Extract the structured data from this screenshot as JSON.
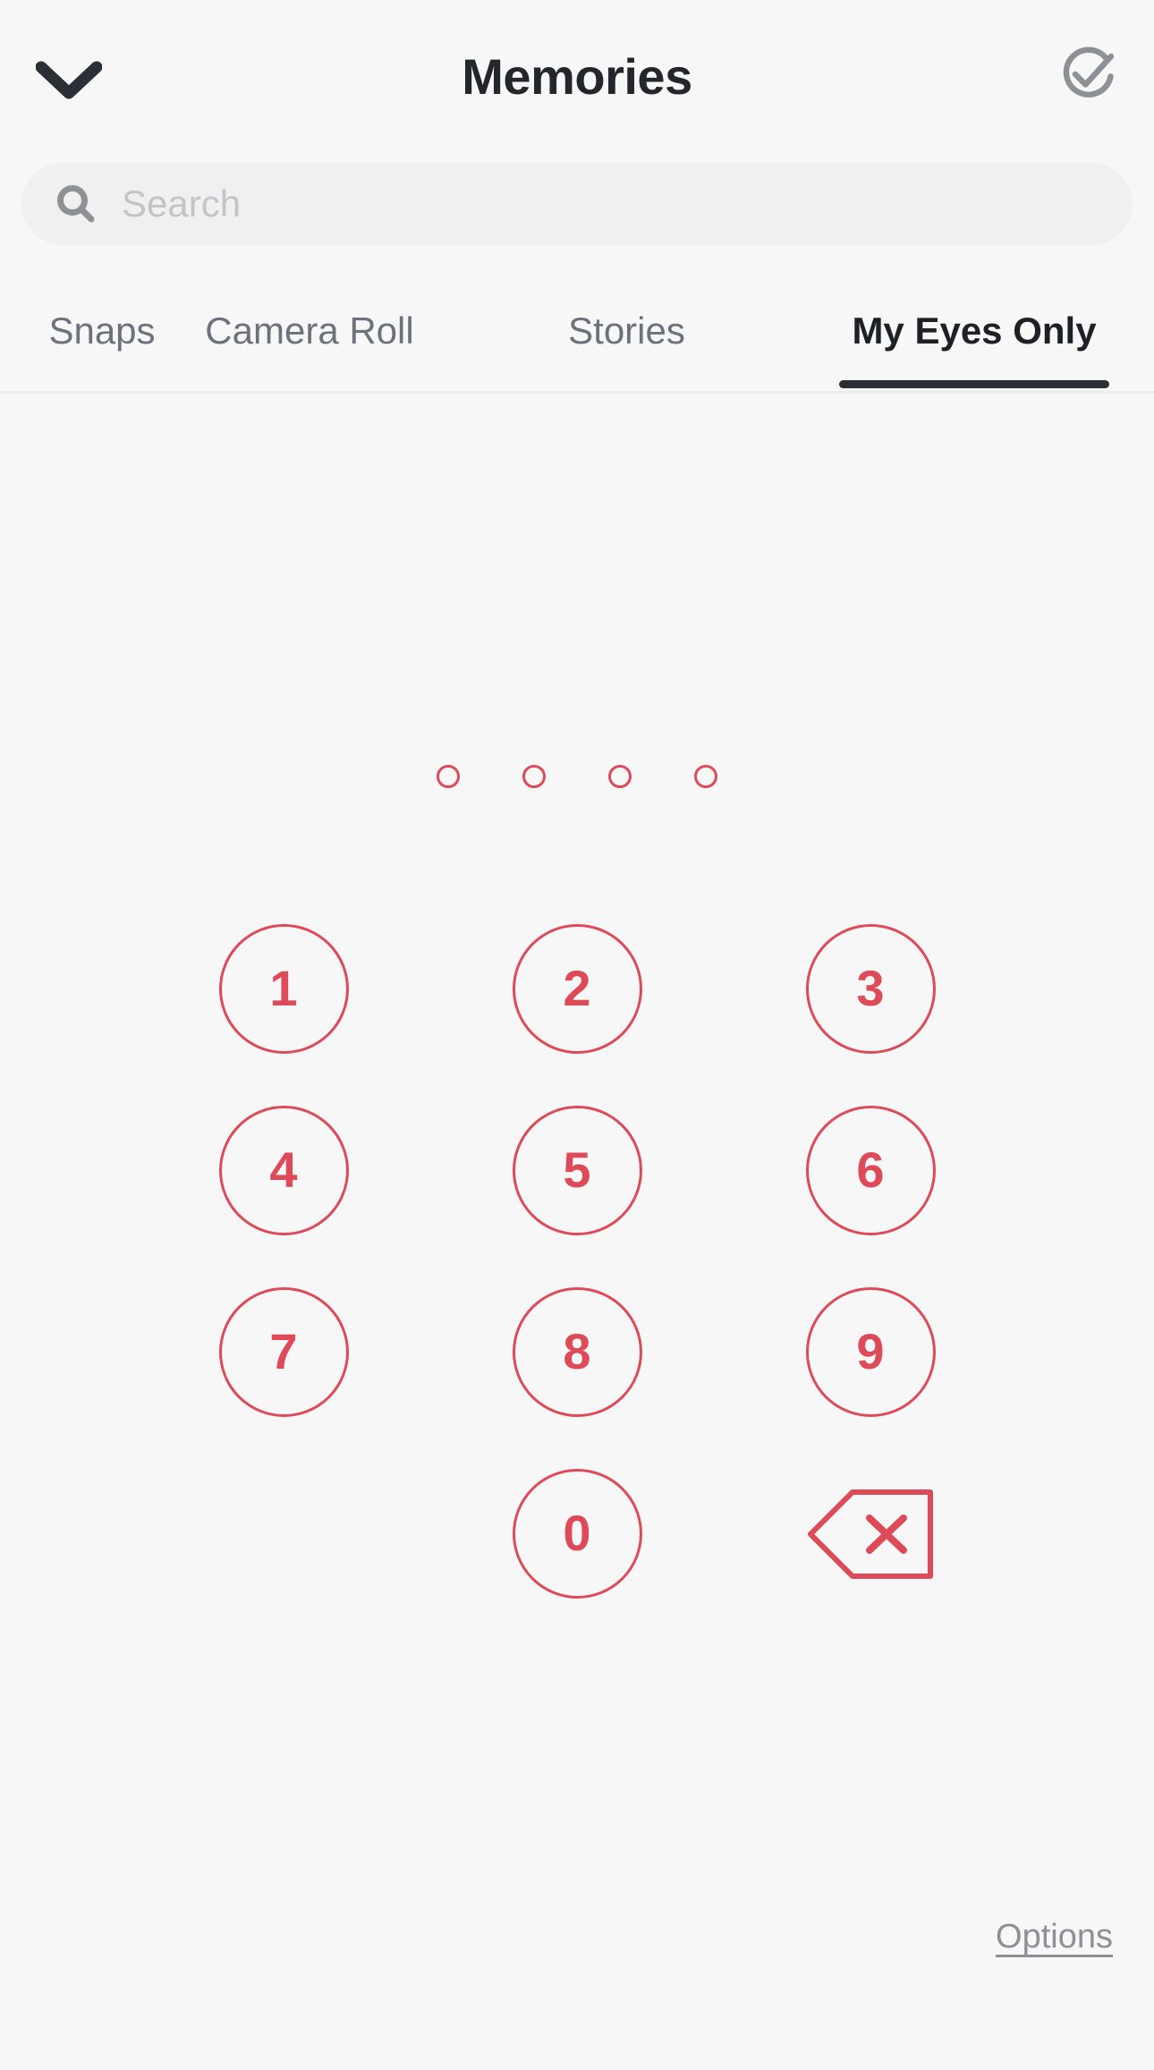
{
  "header": {
    "title": "Memories",
    "back_icon": "chevron-down-icon",
    "select_icon": "check-circle-icon"
  },
  "search": {
    "placeholder": "Search",
    "value": "",
    "icon": "search-icon"
  },
  "tabs": [
    {
      "label": "Snaps",
      "active": false
    },
    {
      "label": "Camera Roll",
      "active": false
    },
    {
      "label": "Stories",
      "active": false
    },
    {
      "label": "My Eyes Only",
      "active": true
    }
  ],
  "passcode": {
    "length": 4,
    "entered": 0,
    "dots": [
      "",
      "",
      "",
      ""
    ]
  },
  "keypad": {
    "keys": [
      [
        "1",
        "2",
        "3"
      ],
      [
        "4",
        "5",
        "6"
      ],
      [
        "7",
        "8",
        "9"
      ]
    ],
    "zero": "0",
    "backspace_icon": "backspace-delete-icon"
  },
  "footer": {
    "options_label": "Options"
  },
  "colors": {
    "accent_red": "#de4a58",
    "background": "#f7f7f7",
    "search_background": "#f0f0f0",
    "tab_inactive": "#6b727c",
    "tab_active": "#1d2024",
    "title": "#23262b",
    "muted": "#8d9195"
  }
}
